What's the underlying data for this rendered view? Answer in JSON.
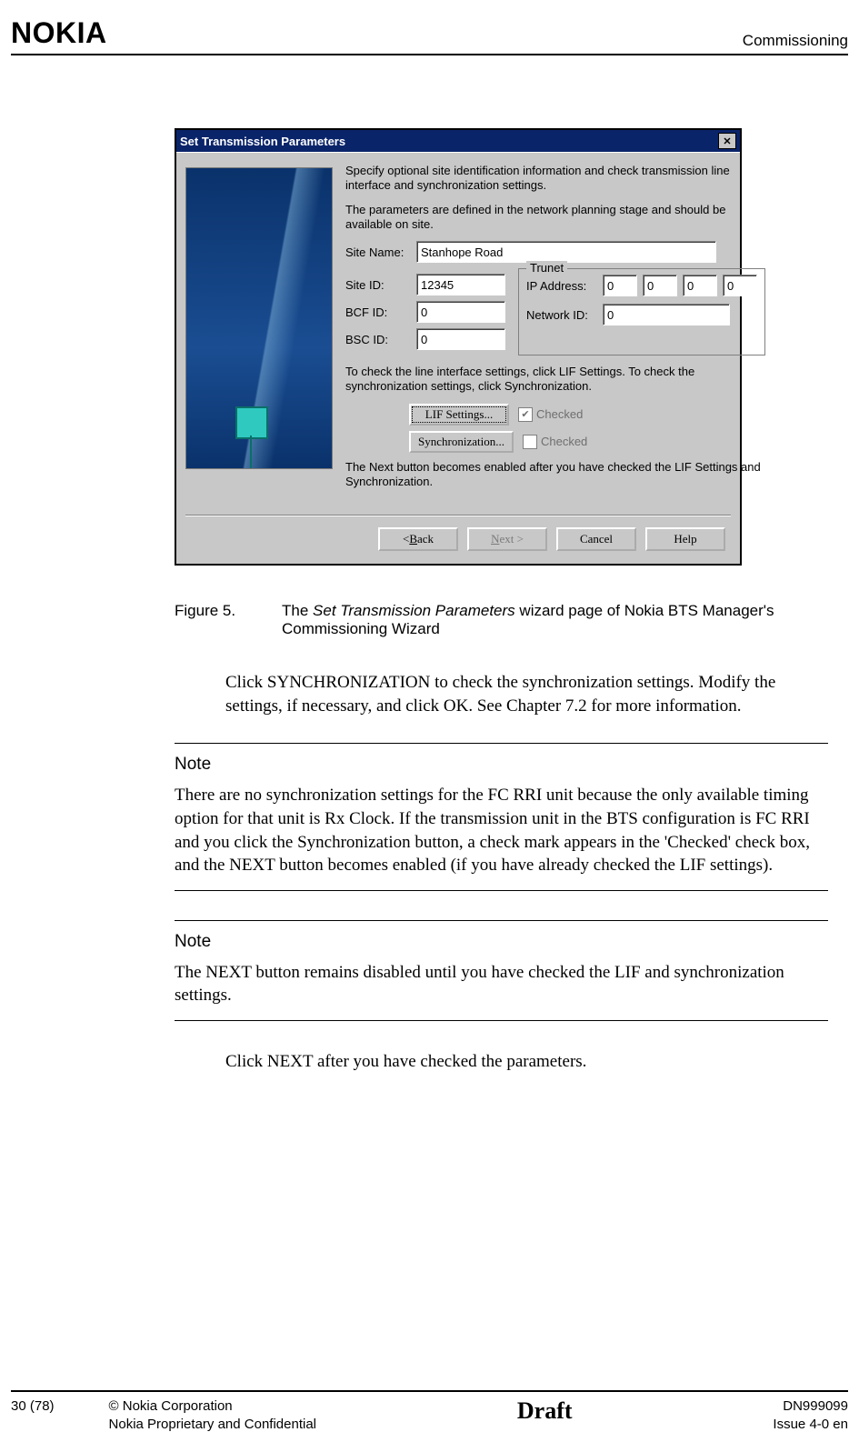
{
  "header": {
    "brand": "NOKIA",
    "section": "Commissioning"
  },
  "dialog": {
    "title": "Set Transmission Parameters",
    "intro1": "Specify optional site identification information and check transmission line interface and synchronization settings.",
    "intro2": "The parameters are defined in the network planning stage and should be available on site.",
    "labels": {
      "site_name": "Site Name:",
      "site_id": "Site ID:",
      "bcf_id": "BCF ID:",
      "bsc_id": "BSC ID:",
      "trunet_legend": "Trunet",
      "ip_address": "IP Address:",
      "network_id": "Network ID:"
    },
    "values": {
      "site_name": "Stanhope Road",
      "site_id": "12345",
      "bcf_id": "0",
      "bsc_id": "0",
      "ip1": "0",
      "ip2": "0",
      "ip3": "0",
      "ip4": "0",
      "network_id": "0"
    },
    "mid_text": "To check the line interface settings, click LIF Settings. To check the synchronization settings, click Synchronization.",
    "lif_btn": "LIF Settings...",
    "sync_btn": "Synchronization...",
    "checked_label": "Checked",
    "next_note": "The Next button becomes enabled after you have checked the LIF Settings and Synchronization.",
    "buttons": {
      "back": "< Back",
      "next": "Next >",
      "cancel": "Cancel",
      "help": "Help"
    }
  },
  "figure": {
    "num": "Figure 5.",
    "text_prefix": "The ",
    "text_italic": "Set Transmission Parameters",
    "text_suffix": " wizard page of Nokia BTS Manager's Commissioning Wizard"
  },
  "body": {
    "para1": "Click SYNCHRONIZATION to check the synchronization settings. Modify the settings, if necessary, and click OK. See Chapter 7.2 for more information.",
    "note1_title": "Note",
    "note1_text": "There are no synchronization settings for the FC RRI unit because the only available timing option for that unit is Rx Clock. If the transmission unit in the BTS configuration is FC RRI and you click the Synchronization button, a check mark appears in the 'Checked' check box, and the NEXT button becomes enabled (if you have already checked the LIF settings).",
    "note2_title": "Note",
    "note2_text": "The NEXT button remains disabled until you have checked the LIF and synchronization settings.",
    "para2": "Click NEXT after you have checked the parameters."
  },
  "footer": {
    "page": "30 (78)",
    "copyright": "© Nokia Corporation",
    "confidential": "Nokia Proprietary and Confidential",
    "watermark": "Draft",
    "docnum": "DN999099",
    "issue": "Issue 4-0 en"
  }
}
